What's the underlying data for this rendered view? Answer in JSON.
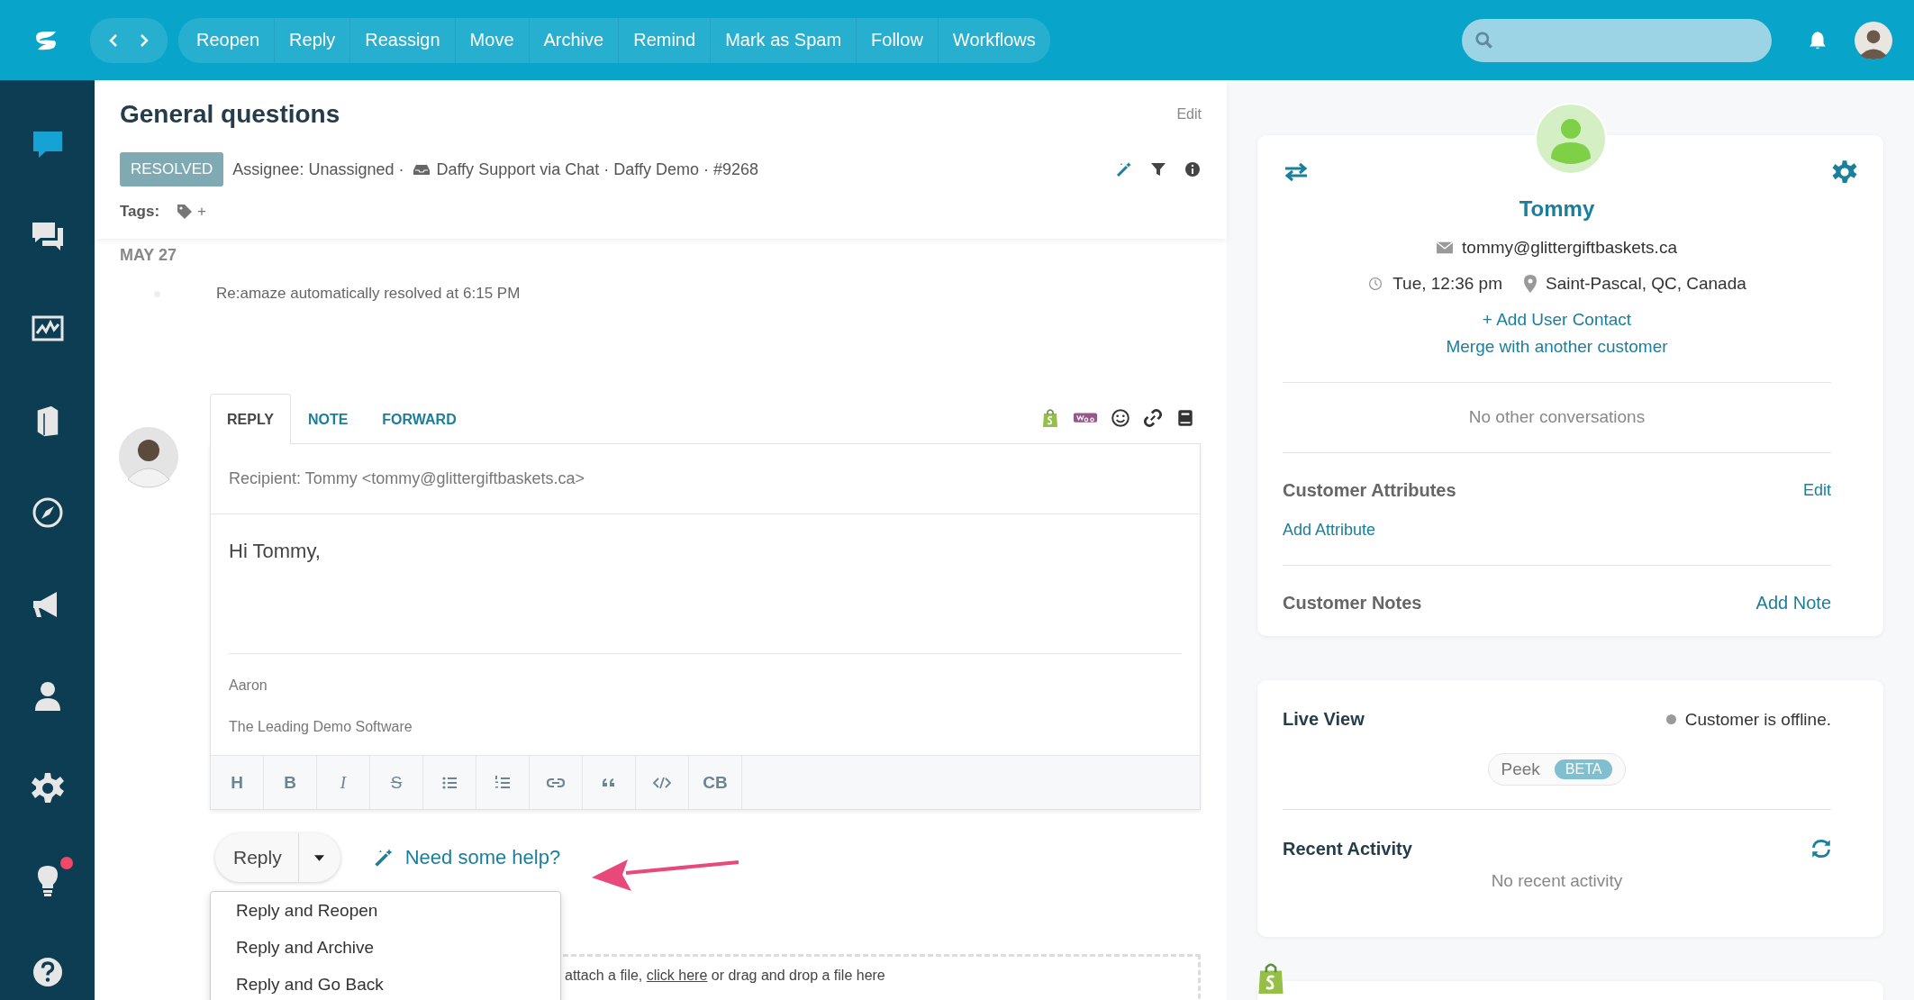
{
  "topbar": {
    "actions": [
      "Reopen",
      "Reply",
      "Reassign",
      "Move",
      "Archive",
      "Remind",
      "Mark as Spam",
      "Follow",
      "Workflows"
    ]
  },
  "sidebar": {
    "items": [
      {
        "selected": true,
        "alert": false
      },
      {
        "selected": false,
        "alert": false
      },
      {
        "selected": false,
        "alert": false
      },
      {
        "selected": false,
        "alert": false
      },
      {
        "selected": false,
        "alert": false
      },
      {
        "selected": false,
        "alert": false
      },
      {
        "selected": false,
        "alert": false
      },
      {
        "selected": false,
        "alert": false
      },
      {
        "selected": false,
        "alert": true
      },
      {
        "selected": false,
        "alert": false
      }
    ]
  },
  "conversation": {
    "title": "General questions",
    "edit": "Edit",
    "status": "RESOLVED",
    "assignee": "Assignee: Unassigned ·",
    "channel": "Daffy Support via Chat · Daffy Demo · #9268",
    "tags_label": "Tags:",
    "tag_add": "+"
  },
  "timeline": {
    "date": "MAY 27",
    "events": [
      "Re:amaze automatically resolved at 6:15 PM"
    ]
  },
  "composer": {
    "tabs": [
      {
        "label": "REPLY",
        "selected": true
      },
      {
        "label": "NOTE",
        "selected": false
      },
      {
        "label": "FORWARD",
        "selected": false
      }
    ],
    "recipient": "Recipient: Tommy <tommy@glittergiftbaskets.ca>",
    "body": "Hi Tommy,",
    "signature": [
      "Aaron",
      "The Leading Demo Software"
    ],
    "format_buttons": [
      {
        "kind": "text",
        "label": "H"
      },
      {
        "kind": "bold",
        "label": "B"
      },
      {
        "kind": "italic",
        "label": "I"
      },
      {
        "kind": "strike",
        "label": "S"
      },
      {
        "kind": "bullets"
      },
      {
        "kind": "numbers"
      },
      {
        "kind": "link"
      },
      {
        "kind": "quote"
      },
      {
        "kind": "code"
      },
      {
        "kind": "text",
        "label": "CB"
      }
    ]
  },
  "send": {
    "button": "Reply",
    "help": "Need some help?",
    "menu": [
      "Reply and Reopen",
      "Reply and Archive",
      "Reply and Go Back"
    ]
  },
  "attach": {
    "before": "attach a file, ",
    "link": "click here",
    "after": " or drag and drop a file here"
  },
  "customer": {
    "name": "Tommy",
    "email": "tommy@glittergiftbaskets.ca",
    "time": "Tue, 12:36 pm",
    "location": "Saint-Pascal, QC, Canada",
    "add_contact": "+ Add User Contact",
    "merge": "Merge with another customer",
    "conversations": "No other conversations",
    "attributes_title": "Customer Attributes",
    "attributes_edit": "Edit",
    "add_attribute": "Add Attribute",
    "notes_title": "Customer Notes",
    "add_note": "Add Note"
  },
  "live_view": {
    "title": "Live View",
    "online": false,
    "status": "Customer is offline.",
    "peek": "Peek",
    "beta": "BETA",
    "activity_title": "Recent Activity",
    "activity_empty": "No recent activity"
  }
}
